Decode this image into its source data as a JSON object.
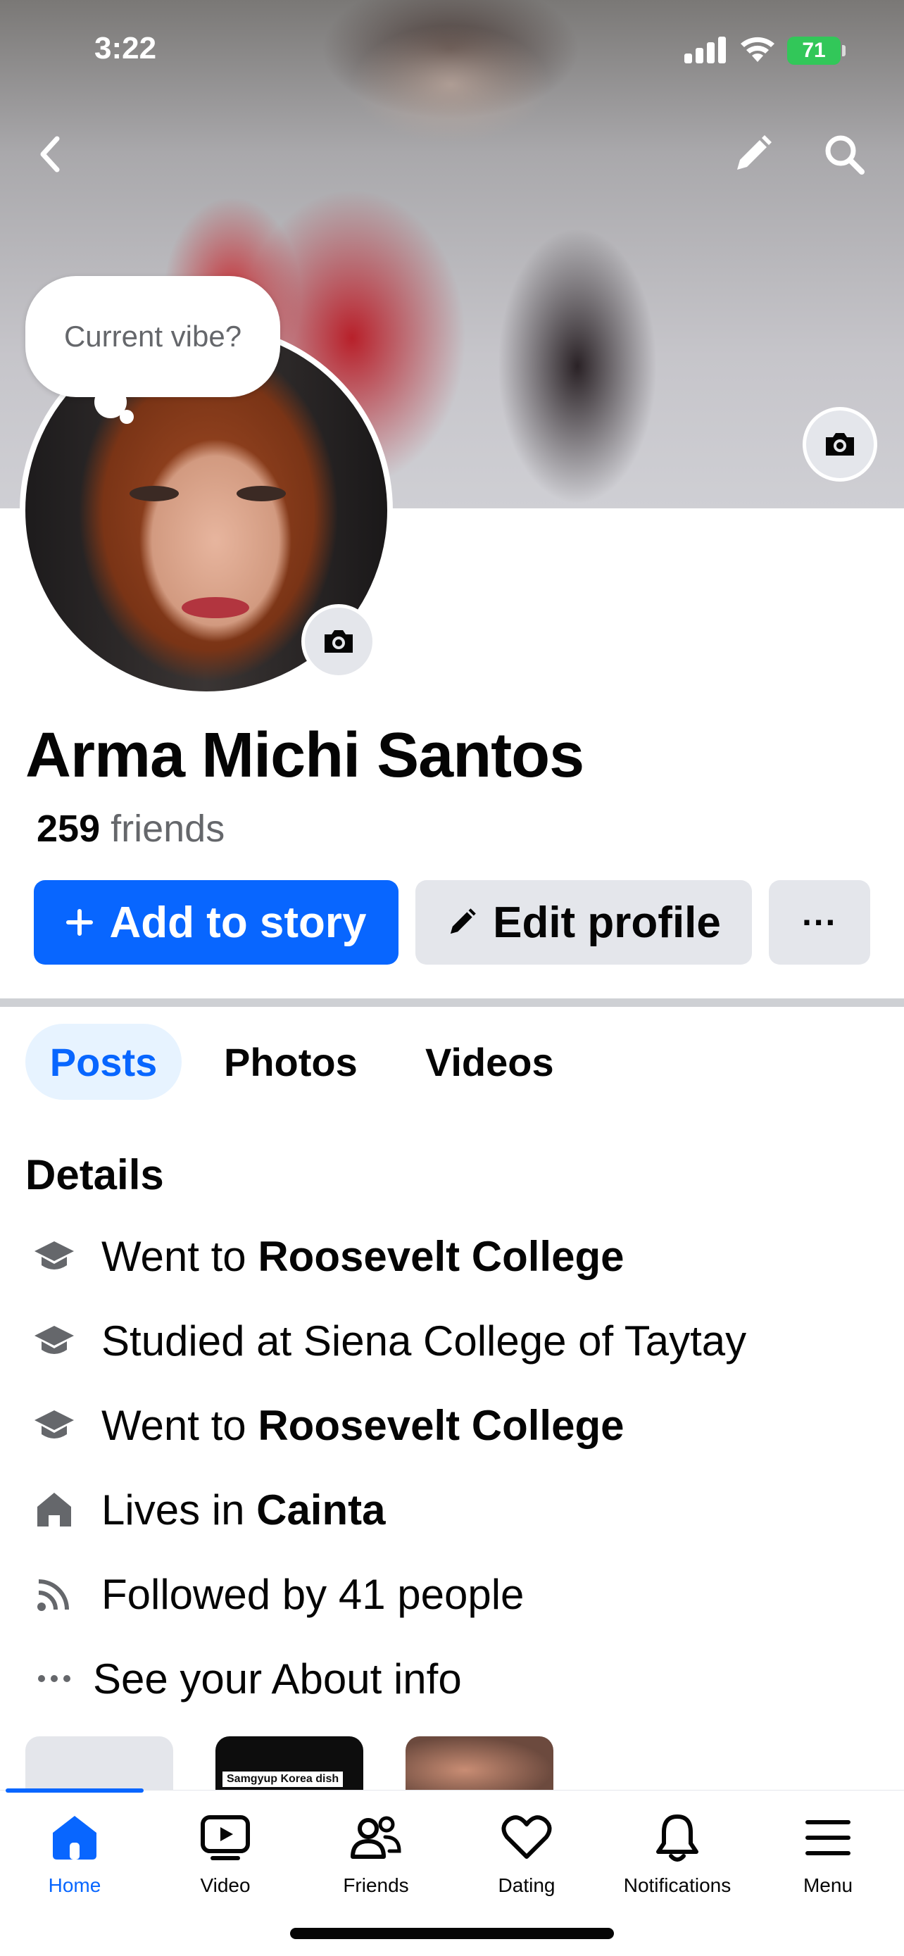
{
  "status_bar": {
    "time": "3:22",
    "battery": "71"
  },
  "cover": {
    "icons": [
      "back-icon",
      "pencil-icon",
      "search-icon",
      "camera-icon"
    ]
  },
  "vibe_bubble": "Current vibe?",
  "profile": {
    "name": "Arma Michi Santos",
    "friends_count": "259",
    "friends_label": "friends"
  },
  "actions": {
    "add_story": "Add to story",
    "edit_profile": "Edit profile",
    "more": "···"
  },
  "tabs": [
    {
      "label": "Posts",
      "active": true
    },
    {
      "label": "Photos",
      "active": false
    },
    {
      "label": "Videos",
      "active": false
    }
  ],
  "details": {
    "title": "Details",
    "items": [
      {
        "icon": "graduation-cap-icon",
        "prefix": "Went to ",
        "bold": "Roosevelt College"
      },
      {
        "icon": "graduation-cap-icon",
        "prefix": "Studied at Siena College of Taytay",
        "bold": ""
      },
      {
        "icon": "graduation-cap-icon",
        "prefix": "Went to ",
        "bold": "Roosevelt College"
      },
      {
        "icon": "home-icon",
        "prefix": "Lives in ",
        "bold": "Cainta"
      },
      {
        "icon": "rss-icon",
        "prefix": "Followed by 41 people",
        "bold": ""
      },
      {
        "icon": "more-dots-icon",
        "prefix": "See your About info",
        "bold": ""
      }
    ]
  },
  "thumbnails": {
    "thumb2_label": "Samgyup Korea dish"
  },
  "bottom_nav": [
    {
      "label": "Home",
      "icon": "home-icon",
      "active": true
    },
    {
      "label": "Video",
      "icon": "video-icon",
      "active": false
    },
    {
      "label": "Friends",
      "icon": "friends-icon",
      "active": false
    },
    {
      "label": "Dating",
      "icon": "heart-icon",
      "active": false
    },
    {
      "label": "Notifications",
      "icon": "bell-icon",
      "active": false
    },
    {
      "label": "Menu",
      "icon": "menu-icon",
      "active": false
    }
  ],
  "colors": {
    "accent": "#0866ff",
    "secondary_button": "#e4e6eb",
    "muted_text": "#65676b"
  }
}
